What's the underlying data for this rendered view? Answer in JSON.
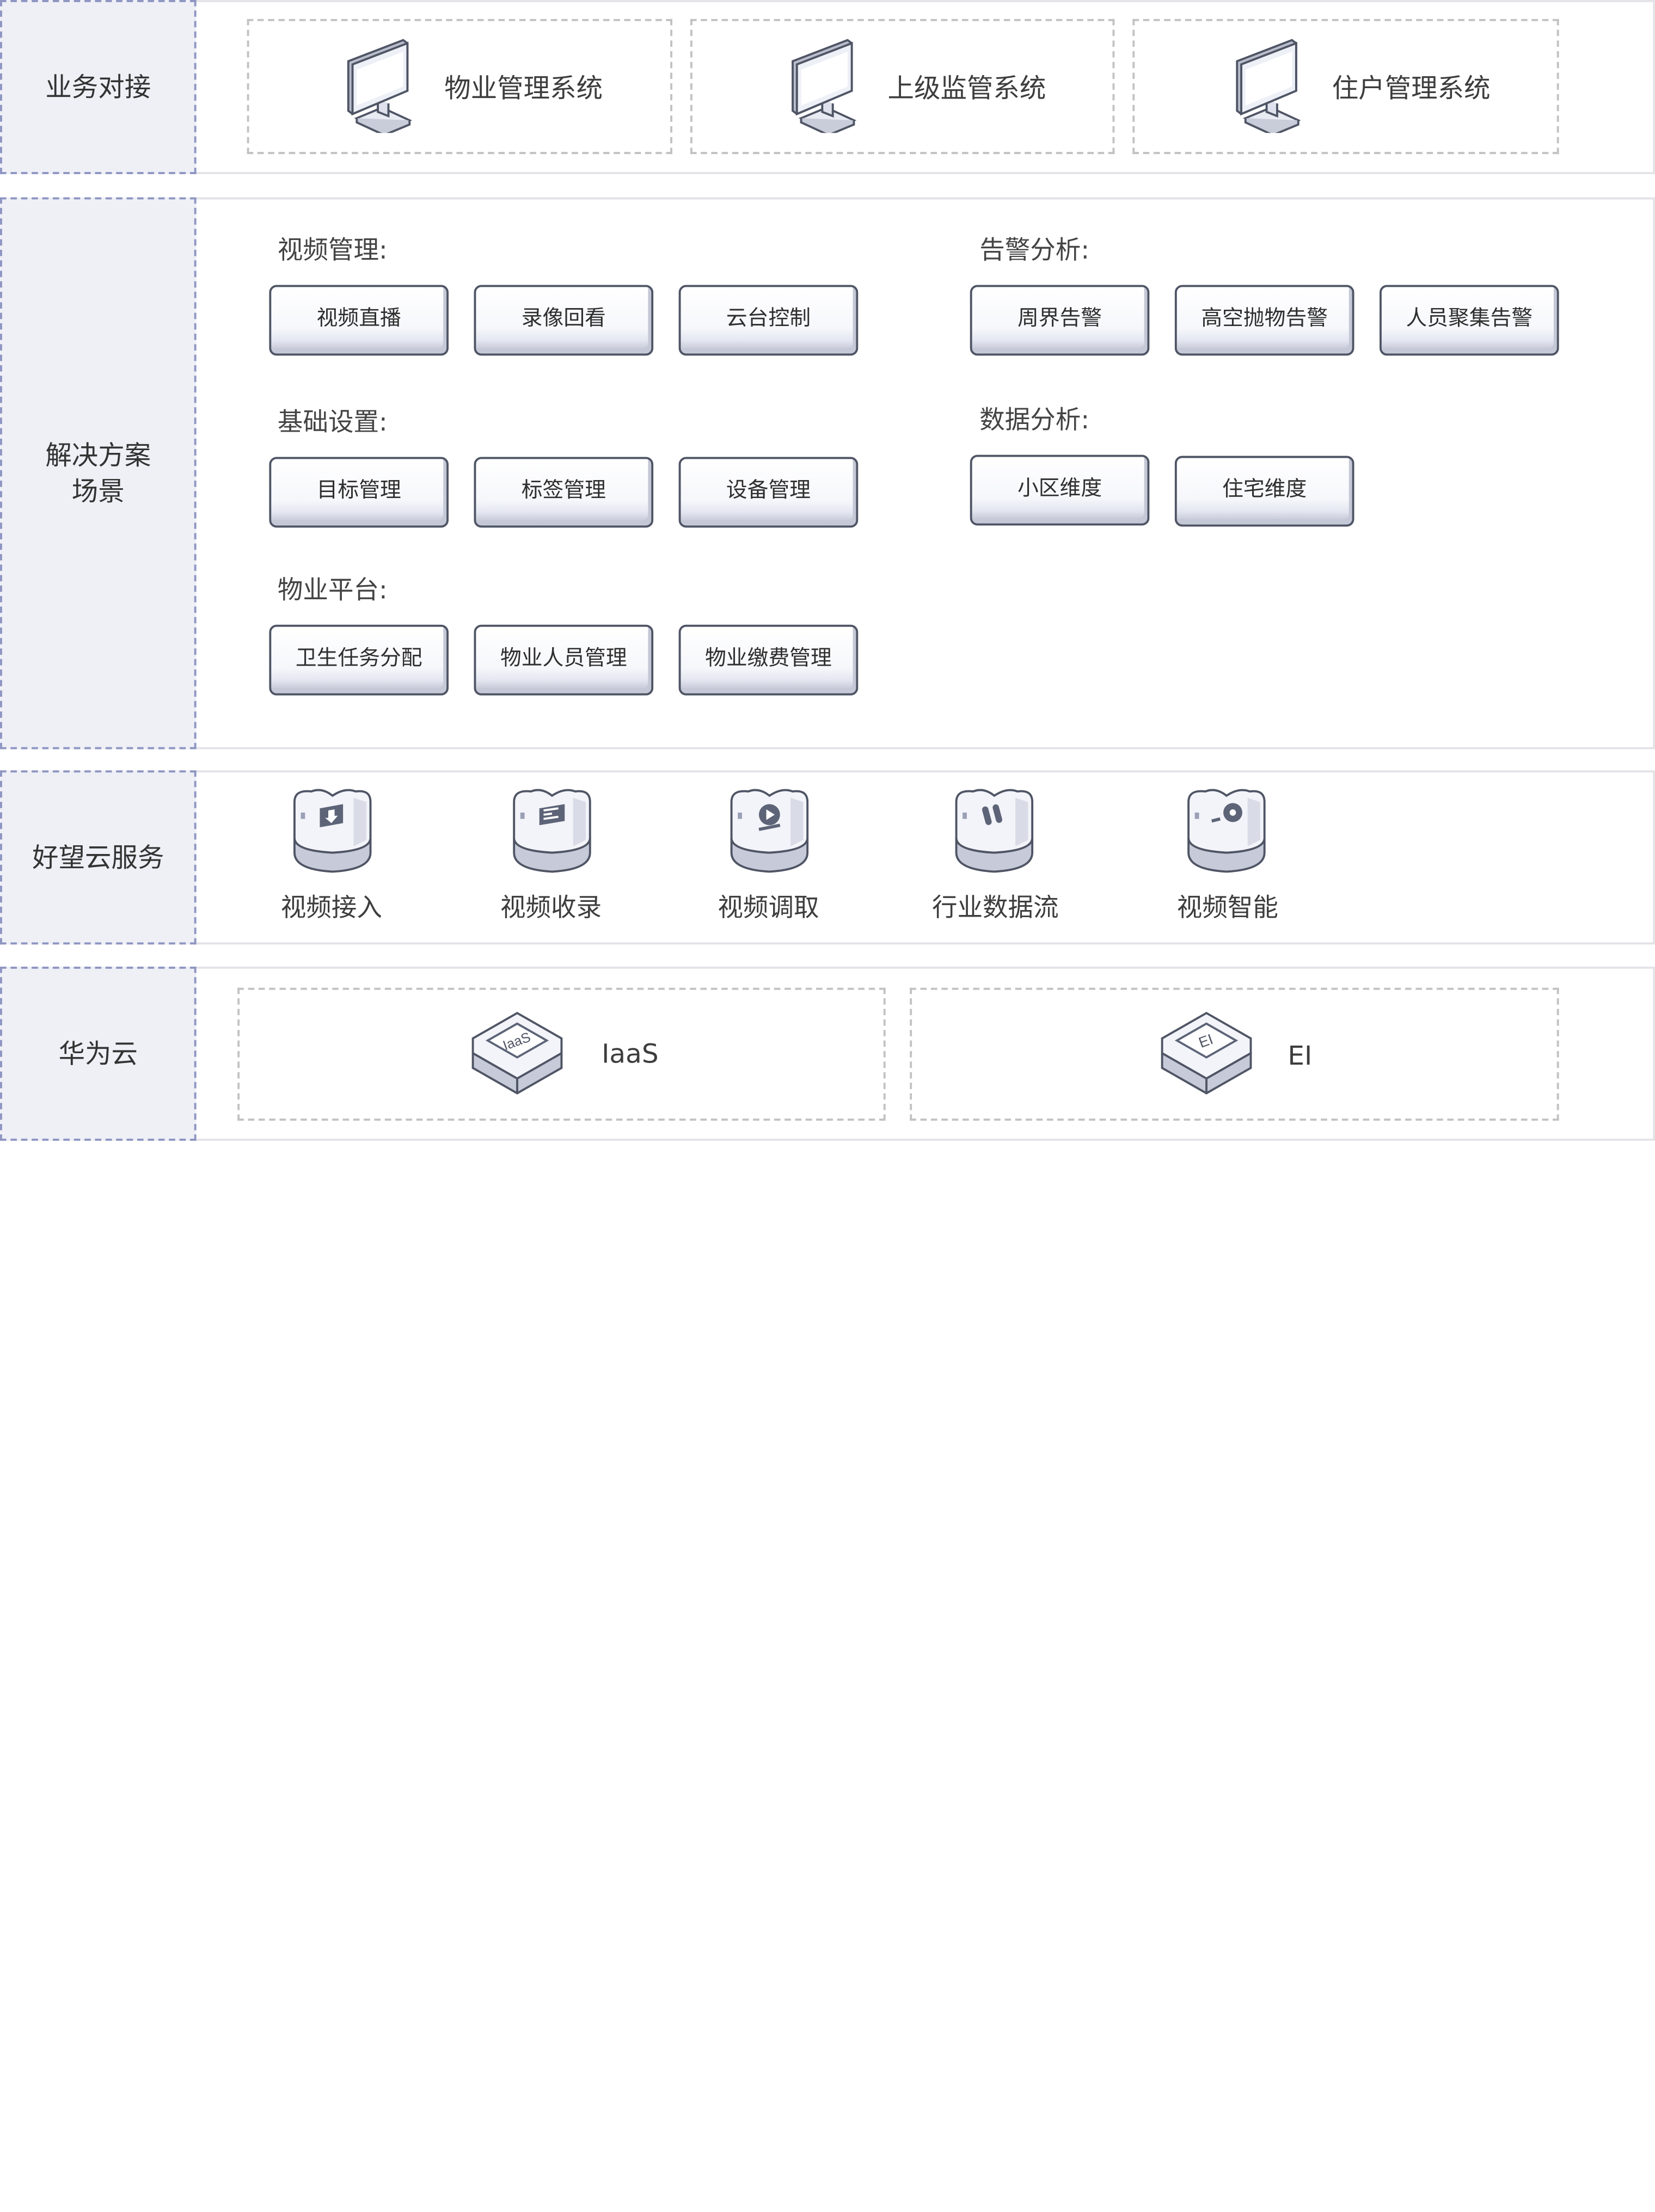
{
  "bands": [
    {
      "label": "业务对接"
    },
    {
      "label": "解决方案\n场景"
    },
    {
      "label": "好望云服务"
    },
    {
      "label": "华为云"
    }
  ],
  "business": [
    {
      "label": "物业管理系统",
      "icon": "monitor-icon"
    },
    {
      "label": "上级监管系统",
      "icon": "monitor-icon"
    },
    {
      "label": "住户管理系统",
      "icon": "monitor-icon"
    }
  ],
  "solutions": [
    {
      "title": "视频管理:",
      "items": [
        "视频直播",
        "录像回看",
        "云台控制"
      ]
    },
    {
      "title": "告警分析:",
      "items": [
        "周界告警",
        "高空抛物告警",
        "人员聚集告警"
      ]
    },
    {
      "title": "基础设置:",
      "items": [
        "目标管理",
        "标签管理",
        "设备管理"
      ]
    },
    {
      "title": "数据分析:",
      "items": [
        "小区维度",
        "住宅维度"
      ]
    },
    {
      "title": "物业平台:",
      "items": [
        "卫生任务分配",
        "物业人员管理",
        "物业缴费管理"
      ]
    }
  ],
  "services": [
    {
      "label": "视频接入",
      "icon": "download-server-icon"
    },
    {
      "label": "视频收录",
      "icon": "record-server-icon"
    },
    {
      "label": "视频调取",
      "icon": "retrieve-server-icon"
    },
    {
      "label": "行业数据流",
      "icon": "dataflow-server-icon"
    },
    {
      "label": "视频智能",
      "icon": "intelligence-server-icon"
    }
  ],
  "cloud": [
    {
      "label": "IaaS",
      "chip": "IaaS",
      "icon": "iaas-chip-icon"
    },
    {
      "label": "EI",
      "chip": "EI",
      "icon": "ei-chip-icon"
    }
  ],
  "colors": {
    "label_bg": "#eef0f6",
    "label_border": "#8f96c2",
    "band_border": "#e3e3e8",
    "button_border": "#4f5565",
    "dashed_box": "#c2c2c2"
  }
}
